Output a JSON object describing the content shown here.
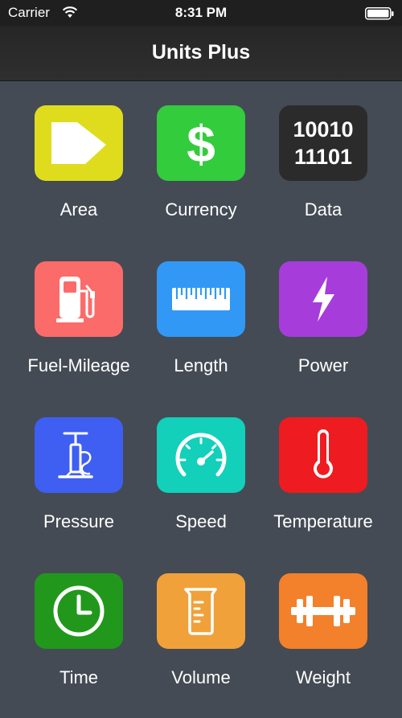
{
  "status_bar": {
    "carrier": "Carrier",
    "time": "8:31 PM"
  },
  "nav": {
    "title": "Units Plus"
  },
  "categories": [
    {
      "label": "Area",
      "color": "#dfdc1e",
      "icon": "area-shape-icon"
    },
    {
      "label": "Currency",
      "color": "#33cc3d",
      "icon": "dollar-sign-icon"
    },
    {
      "label": "Data",
      "color": "#2b2b2b",
      "icon": "binary-digits-icon",
      "icon_text": [
        "10010",
        "11101"
      ]
    },
    {
      "label": "Fuel-Mileage",
      "color": "#fb6b6a",
      "icon": "fuel-pump-icon"
    },
    {
      "label": "Length",
      "color": "#3199f5",
      "icon": "ruler-icon"
    },
    {
      "label": "Power",
      "color": "#a63ddb",
      "icon": "lightning-bolt-icon"
    },
    {
      "label": "Pressure",
      "color": "#3e5ff2",
      "icon": "air-pump-icon"
    },
    {
      "label": "Speed",
      "color": "#12d0ba",
      "icon": "speedometer-icon"
    },
    {
      "label": "Temperature",
      "color": "#ee1c20",
      "icon": "thermometer-icon"
    },
    {
      "label": "Time",
      "color": "#21981b",
      "icon": "clock-icon"
    },
    {
      "label": "Volume",
      "color": "#f0a13a",
      "icon": "measuring-cup-icon"
    },
    {
      "label": "Weight",
      "color": "#f3802a",
      "icon": "dumbbell-icon"
    }
  ]
}
